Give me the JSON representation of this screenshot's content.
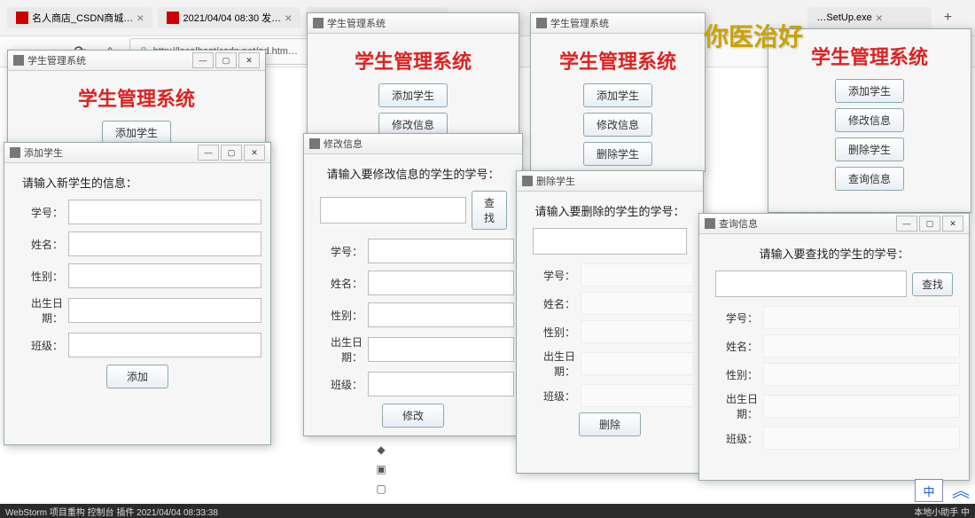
{
  "browser": {
    "tabs": [
      {
        "title": "名人商店_CSDN商城…",
        "fav": "#c00"
      },
      {
        "title": "2021/04/04 08:30 发…",
        "fav": "#c00"
      },
      {
        "title": ""
      },
      {
        "title": "…SetUp.exe"
      }
    ],
    "winctrls": {
      "min": "—",
      "max": "▢",
      "close": "✕"
    },
    "newtab": "+",
    "toolbar": {
      "back": "←",
      "fwd": "→",
      "reload": "⟳",
      "home": "⌂",
      "lock": "🔒"
    },
    "address": "http://localhost/csdn.net/ad.htm…"
  },
  "watermark": "你医治好",
  "common": {
    "systemTitle": "学生管理系统",
    "btnAdd": "添加学生",
    "btnEdit": "修改信息",
    "btnDelete": "删除学生",
    "btnQuery": "查询信息",
    "labelId": "学号：",
    "labelName": "姓名：",
    "labelSex": "性别：",
    "labelBirth": "出生日期：",
    "labelClass": "班级：",
    "btnSearch": "查找",
    "winmin": "—",
    "winmax": "▢",
    "winclose": "✕"
  },
  "w1": {
    "title": "学生管理系统"
  },
  "w2": {
    "title": "添加学生",
    "prompt": "请输入新学生的信息：",
    "btn": "添加"
  },
  "w3": {
    "title": "学生管理系统"
  },
  "w4": {
    "title": "修改信息",
    "prompt": "请输入要修改信息的学生的学号：",
    "btn": "修改"
  },
  "w5": {
    "title": "学生管理系统"
  },
  "w6": {
    "title": "删除学生",
    "prompt": "请输入要删除的学生的学号：",
    "btn": "删除"
  },
  "w7": {
    "title": "学生管理系统"
  },
  "w8": {
    "title": "查询信息",
    "prompt": "请输入要查找的学生的学号："
  },
  "taskbar": {
    "left": "WebStorm  项目重构  控制台  插件  2021/04/04  08:33:38",
    "right": "本地小助手  中"
  },
  "ime": "中",
  "eclipse": {
    "a": "◆",
    "b": "▣",
    "c": "▢"
  }
}
